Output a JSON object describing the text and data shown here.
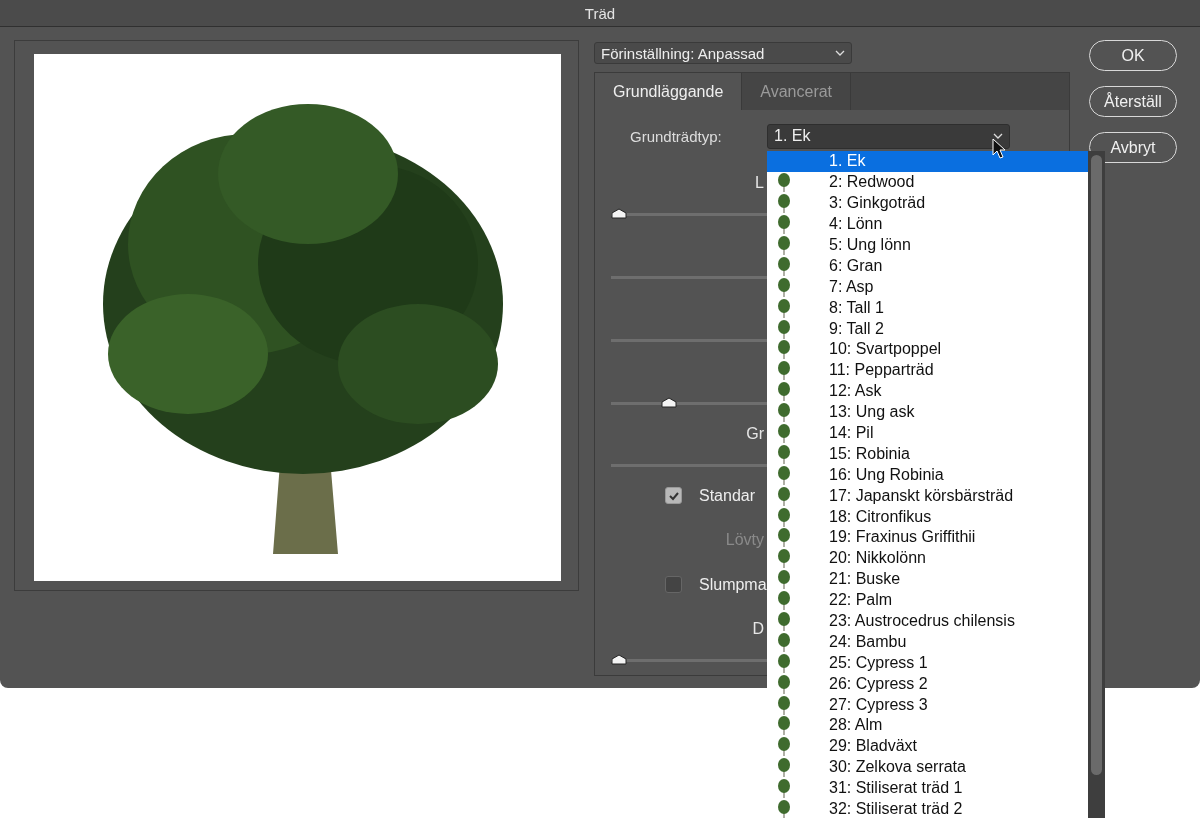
{
  "window": {
    "title": "Träd"
  },
  "preset": {
    "value": "Förinställning: Anpassad"
  },
  "tabs": [
    {
      "label": "Grundläggande",
      "selected": true
    },
    {
      "label": "Avancerat",
      "selected": false
    }
  ],
  "base_tree_type": {
    "label": "Grundträdtyp:",
    "value": "1. Ek"
  },
  "controls": [
    {
      "kind": "label",
      "text": "L",
      "disabled": false
    },
    {
      "kind": "slider",
      "level": 0
    },
    {
      "kind": "slider"
    },
    {
      "kind": "slider"
    },
    {
      "kind": "slider",
      "level": 0.12
    },
    {
      "kind": "label",
      "text": "Gr",
      "disabled": false
    },
    {
      "kind": "slider"
    },
    {
      "kind": "checkbox",
      "text": "Standar",
      "checked": true
    },
    {
      "kind": "label",
      "text": "Lövty",
      "disabled": true
    },
    {
      "kind": "checkbox",
      "text": "Slumpma",
      "checked": false
    },
    {
      "kind": "label",
      "text": "D",
      "disabled": false
    },
    {
      "kind": "slider",
      "level": 0
    }
  ],
  "buttons": [
    "OK",
    "Återställ",
    "Avbryt"
  ],
  "tree_type_list": [
    {
      "label": "1. Ek",
      "selected": true
    },
    {
      "label": "2: Redwood",
      "selected": false
    },
    {
      "label": "3: Ginkgoträd",
      "selected": false
    },
    {
      "label": "4: Lönn",
      "selected": false
    },
    {
      "label": "5: Ung lönn",
      "selected": false
    },
    {
      "label": "6: Gran",
      "selected": false
    },
    {
      "label": "7: Asp",
      "selected": false
    },
    {
      "label": "8: Tall 1",
      "selected": false
    },
    {
      "label": "9: Tall 2",
      "selected": false
    },
    {
      "label": "10: Svartpoppel",
      "selected": false
    },
    {
      "label": "11: Pepparträd",
      "selected": false
    },
    {
      "label": "12: Ask",
      "selected": false
    },
    {
      "label": "13: Ung ask",
      "selected": false
    },
    {
      "label": "14: Pil",
      "selected": false
    },
    {
      "label": "15: Robinia",
      "selected": false
    },
    {
      "label": "16: Ung Robinia",
      "selected": false
    },
    {
      "label": "17: Japanskt körsbärsträd",
      "selected": false
    },
    {
      "label": "18: Citronfikus",
      "selected": false
    },
    {
      "label": "19: Fraxinus Griffithii",
      "selected": false
    },
    {
      "label": "20: Nikkolönn",
      "selected": false
    },
    {
      "label": "21: Buske",
      "selected": false
    },
    {
      "label": "22: Palm",
      "selected": false
    },
    {
      "label": "23: Austrocedrus chilensis",
      "selected": false
    },
    {
      "label": "24: Bambu",
      "selected": false
    },
    {
      "label": "25: Cypress 1",
      "selected": false
    },
    {
      "label": "26: Cypress 2",
      "selected": false
    },
    {
      "label": "27: Cypress 3",
      "selected": false
    },
    {
      "label": "28: Alm",
      "selected": false
    },
    {
      "label": "29: Bladväxt",
      "selected": false
    },
    {
      "label": "30: Zelkova serrata",
      "selected": false
    },
    {
      "label": "31: Stiliserat träd 1",
      "selected": false
    },
    {
      "label": "32: Stiliserat träd 2",
      "selected": false
    }
  ]
}
